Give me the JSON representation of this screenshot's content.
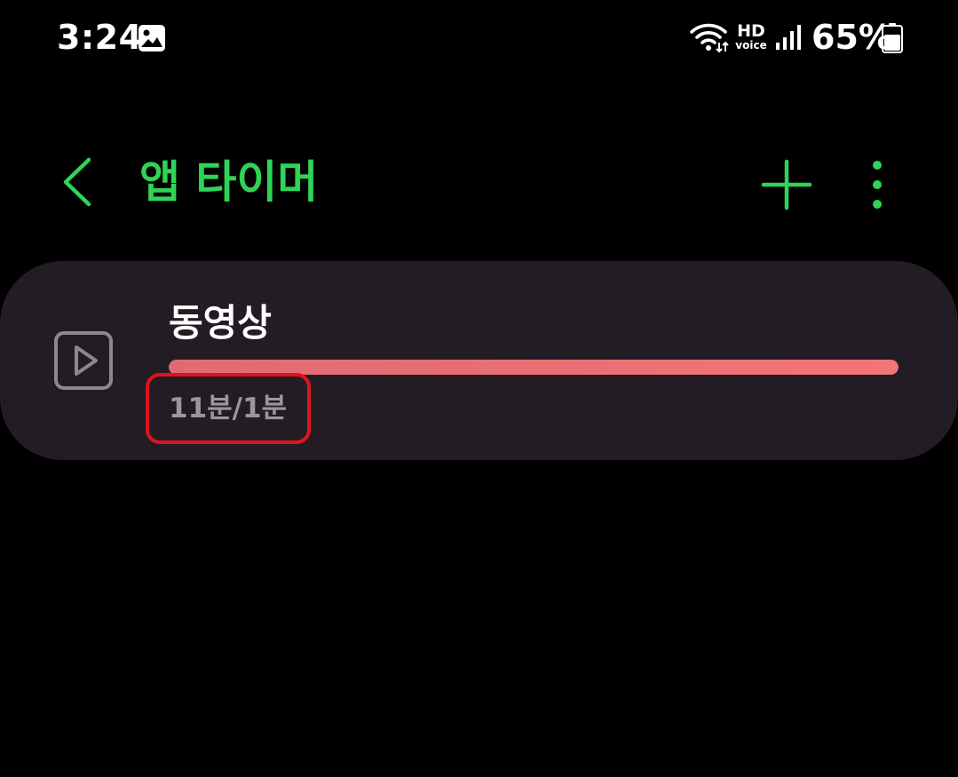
{
  "status_bar": {
    "time": "3:24",
    "notification_icon": "gallery-icon",
    "wifi_icon": "wifi-icon",
    "hd_label": "HD",
    "voice_label": "voice",
    "signal_icon": "signal-icon",
    "battery_percent": "65%",
    "battery_icon": "battery-icon"
  },
  "header": {
    "title": "앱 타이머",
    "back_icon": "chevron-left-icon",
    "add_icon": "plus-icon",
    "more_icon": "more-vert-icon"
  },
  "timers": [
    {
      "icon": "play-icon",
      "app_name": "동영상",
      "usage": "11분/1분",
      "progress_percent": 100
    }
  ],
  "colors": {
    "accent": "#2fd457",
    "background": "#000000",
    "card": "#231c24",
    "progress": "#f27578",
    "usage_text": "#9b969a",
    "highlight": "#e0131c"
  }
}
